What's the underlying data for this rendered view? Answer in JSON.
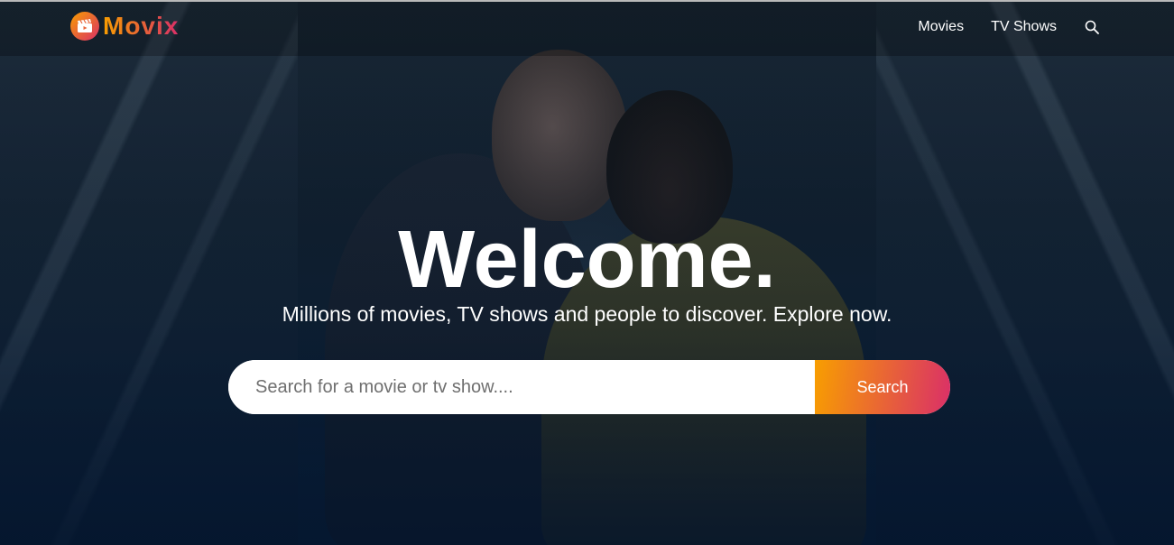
{
  "header": {
    "logo_text": "Movix",
    "nav": [
      {
        "label": "Movies"
      },
      {
        "label": "TV Shows"
      }
    ],
    "search_icon": "search-icon"
  },
  "hero": {
    "title": "Welcome.",
    "subtitle": "Millions of movies, TV shows and people to discover. Explore now.",
    "search": {
      "placeholder": "Search for a movie or tv show....",
      "value": "",
      "button_label": "Search"
    }
  },
  "colors": {
    "accent_start": "#f89e00",
    "accent_end": "#da2f68",
    "background": "#04152d"
  }
}
